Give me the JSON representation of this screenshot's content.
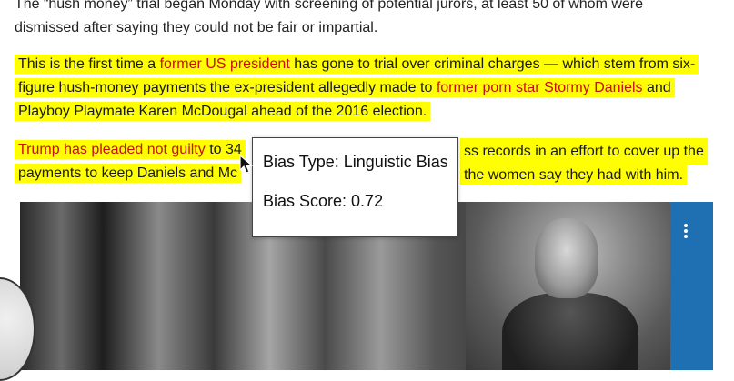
{
  "article": {
    "top_line_1": "The “hush money” trial began Monday with screening of potential jurors, at least 50 of whom were",
    "top_line_2": "dismissed after saying they could not be fair or impartial.",
    "p1_seg1": "This is the first time a ",
    "p1_link1": "former US president",
    "p1_seg2": " has gone to trial over criminal charges — which stem from six-figure hush-money payments the ex-president allegedly made to ",
    "p1_link2": "former porn star Stormy Daniels",
    "p1_seg3": " and Playboy Playmate Karen McDougal ahead of the 2016 election.",
    "p2_link1": "Trump has pleaded not guilty",
    "p2_seg1": " to 34 ",
    "p2_seg1_right": "ss records in an effort to cover up the",
    "p2_seg2_left": "payments to keep Daniels and Mc",
    "p2_seg2_right": " the women say they had with him."
  },
  "tooltip": {
    "bias_type": "Bias Type: Linguistic Bias",
    "bias_score": "Bias Score: 0.72"
  },
  "colors": {
    "highlight": "#ffff00",
    "link_red": "#c80f0f",
    "media_sidebar": "#1f6fb3"
  },
  "icons": {
    "cursor": "mouse-pointer-icon",
    "more": "kebab-menu-icon"
  }
}
